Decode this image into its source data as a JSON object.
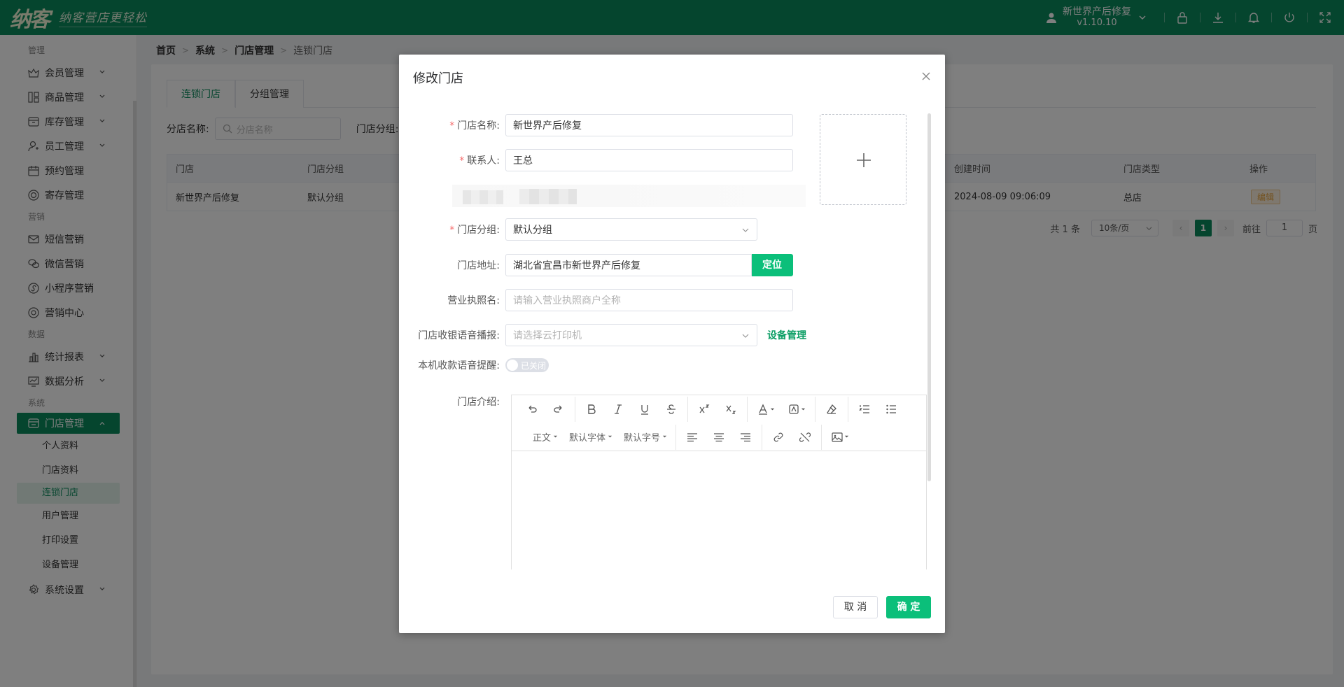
{
  "header": {
    "logo": "纳客",
    "slogan": "纳客营店更轻松",
    "user_name": "新世界产后修复",
    "version": "v1.10.10"
  },
  "sidebar": {
    "groups": [
      {
        "title": "管理",
        "items": [
          "会员管理",
          "商品管理",
          "库存管理",
          "员工管理",
          "预约管理",
          "寄存管理"
        ]
      },
      {
        "title": "营销",
        "items": [
          "短信营销",
          "微信营销",
          "小程序营销",
          "营销中心"
        ]
      },
      {
        "title": "数据",
        "items": [
          "统计报表",
          "数据分析"
        ]
      },
      {
        "title": "系统"
      }
    ],
    "active_item": "门店管理",
    "sub_items": [
      "个人资料",
      "门店资料",
      "连锁门店",
      "用户管理",
      "打印设置",
      "设备管理"
    ],
    "settings_item": "系统设置"
  },
  "breadcrumb": [
    "首页",
    "系统",
    "门店管理",
    "连锁门店"
  ],
  "tabs": [
    "连锁门店",
    "分组管理"
  ],
  "filters": {
    "name_label": "分店名称:",
    "name_placeholder": "分店名称",
    "group_label": "门店分组:"
  },
  "table": {
    "headers": [
      "门店",
      "门店分组",
      "创建时间",
      "门店类型",
      "操作"
    ],
    "rows": [
      {
        "store": "新世界产后修复",
        "group": "默认分组",
        "created": "2024-08-09 09:06:09",
        "type": "总店",
        "action": "编辑"
      }
    ]
  },
  "pager": {
    "total": "共 1 条",
    "size": "10条/页",
    "current": "1",
    "goto_label": "前往",
    "goto_value": "1",
    "page_suffix": "页"
  },
  "modal": {
    "title": "修改门店",
    "fields": {
      "name_label": "门店名称:",
      "name_value": "新世界产后修复",
      "contact_label": "联系人:",
      "contact_value": "王总",
      "group_label": "门店分组:",
      "group_value": "默认分组",
      "address_label": "门店地址:",
      "address_value": "湖北省宜昌市新世界产后修复",
      "locate_button": "定位",
      "license_label": "营业执照名:",
      "license_placeholder": "请输入营业执照商户全称",
      "voice_label": "门店收银语音播报:",
      "voice_placeholder": "请选择云打印机",
      "device_link": "设备管理",
      "local_voice_label": "本机收款语音提醒:",
      "switch_text": "已关闭",
      "intro_label": "门店介绍:"
    },
    "editor": {
      "paragraph": "正文",
      "font_family": "默认字体",
      "font_size": "默认字号"
    },
    "cancel": "取 消",
    "confirm": "确 定"
  }
}
